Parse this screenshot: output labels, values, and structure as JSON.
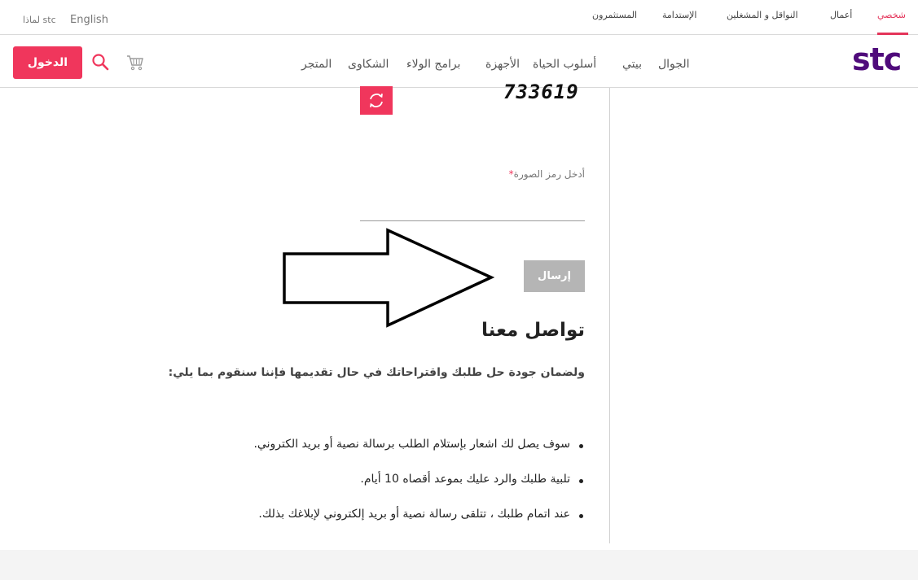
{
  "topbar": {
    "segments": [
      "شخصي",
      "أعمال",
      "النواقل و المشغلين",
      "الإستدامة",
      "المستثمرون"
    ],
    "active_segment": "شخصي",
    "language": "English",
    "why_stc": "لماذا stc"
  },
  "mainnav": {
    "logo": "stc",
    "items": [
      "الجوال",
      "بيتي",
      "أسلوب الحياة",
      "الأجهزة",
      "برامج الولاء",
      "الشكاوى",
      "المتجر"
    ],
    "login_label": "الدخول"
  },
  "captcha": {
    "code": "733619",
    "field_label": "أدخل رمز الصورة",
    "required_mark": "*",
    "input_value": "",
    "submit_label": "إرسال"
  },
  "contact": {
    "title": "تواصل معنا",
    "intro": "ولضمان جودة حل طلبك واقتراحاتك في حال تقديمها فإننا سنقوم بما يلي:",
    "bullets": [
      "سوف يصل لك اشعار بإستلام الطلب برسالة نصية أو بريد الكتروني.",
      "تلبية طلبك والرد عليك بموعد أقصاه 10 أيام.",
      "عند اتمام طلبك ، تتلقى رسالة نصية أو بريد إلكتروني لإبلاغك بذلك."
    ]
  },
  "colors": {
    "brand_purple": "#4f0b7b",
    "accent_pink": "#f0365c",
    "disabled_gray": "#b5b5b5"
  },
  "icons": [
    "search-icon",
    "cart-icon",
    "refresh-icon",
    "arrow-annotation-icon"
  ]
}
